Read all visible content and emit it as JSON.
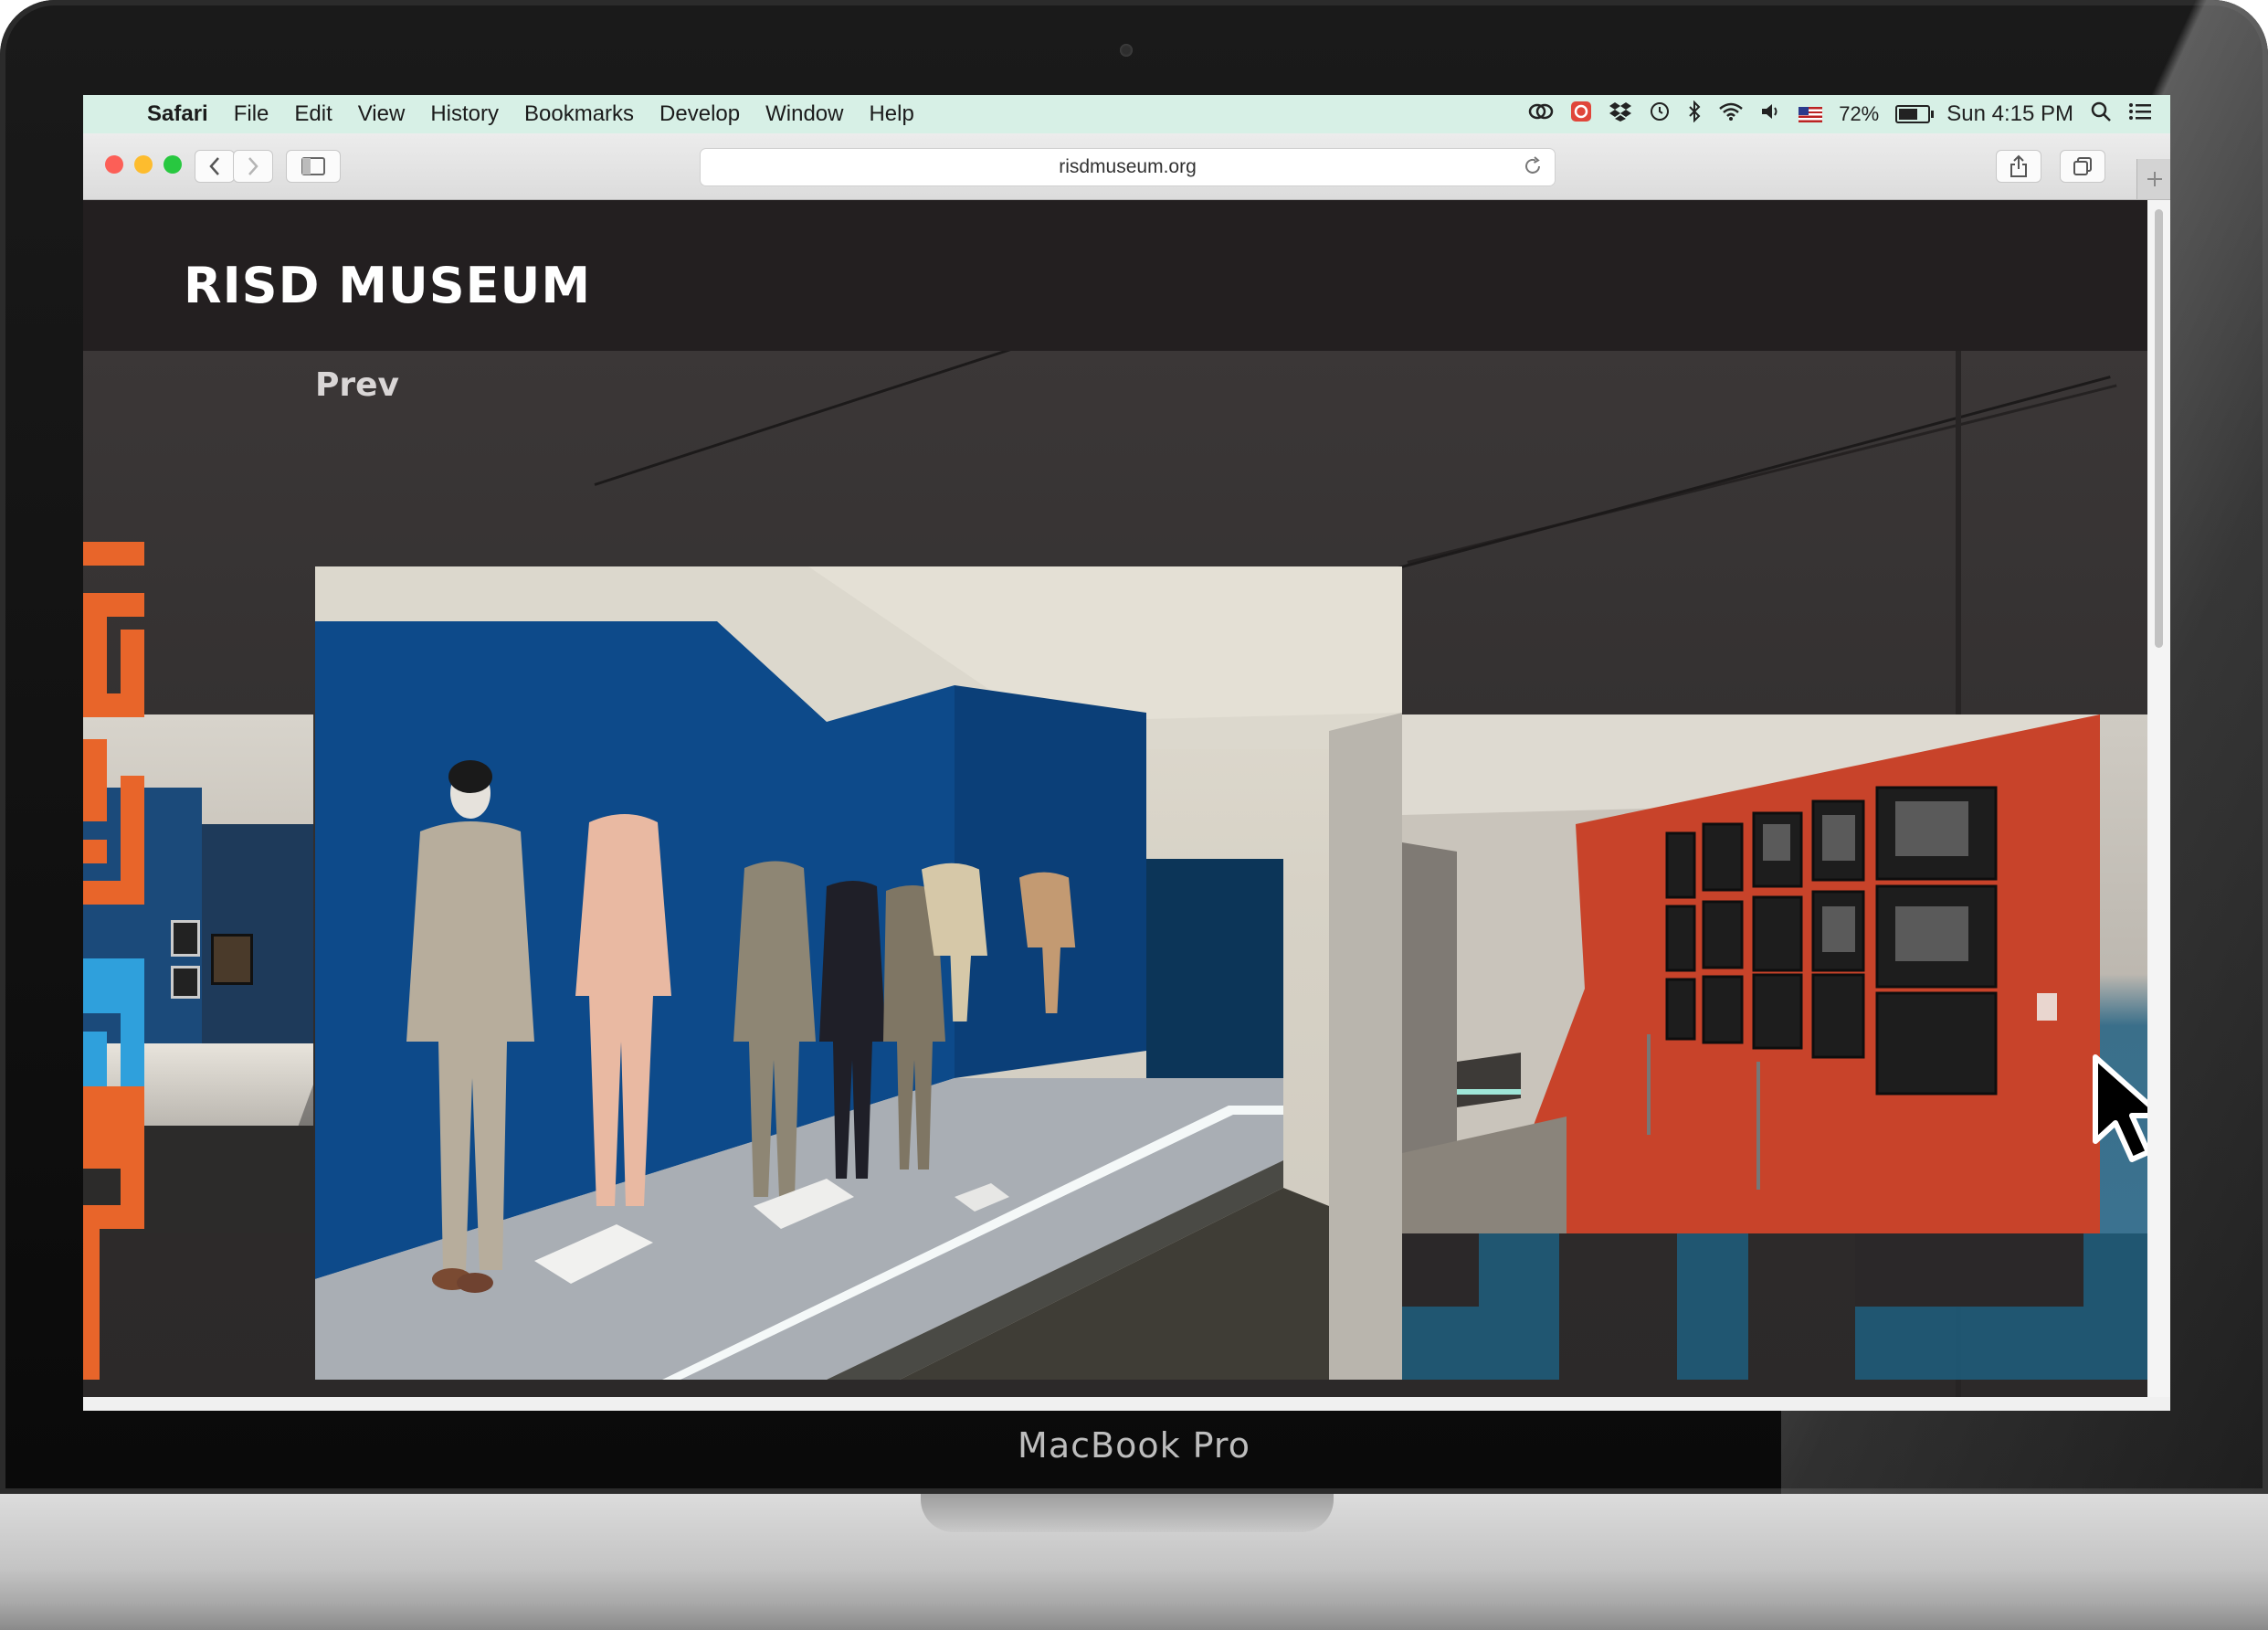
{
  "device": {
    "brand_label": "MacBook Pro"
  },
  "menubar": {
    "app_name": "Safari",
    "items": [
      "File",
      "Edit",
      "View",
      "History",
      "Bookmarks",
      "Develop",
      "Window",
      "Help"
    ],
    "battery_percent": "72%",
    "clock": "Sun 4:15 PM",
    "battery_level": 0.72,
    "colors": {
      "background": "#d7f0e6"
    }
  },
  "browser": {
    "url": "risdmuseum.org",
    "icons": [
      "back-icon",
      "forward-icon",
      "sidebar-icon",
      "reload-icon",
      "share-icon",
      "tabs-icon",
      "new-tab-icon"
    ]
  },
  "page": {
    "logo": "RISD MUSEUM",
    "prev_label": "Prev",
    "colors": {
      "header": "#231f20",
      "accent_orange": "#e8652a",
      "accent_blue": "#2fa0dc",
      "accent_teal": "#1f5e7e",
      "gallery_wall_blue": "#0d4a8a",
      "gallery_wall_red": "#c8432a"
    }
  }
}
